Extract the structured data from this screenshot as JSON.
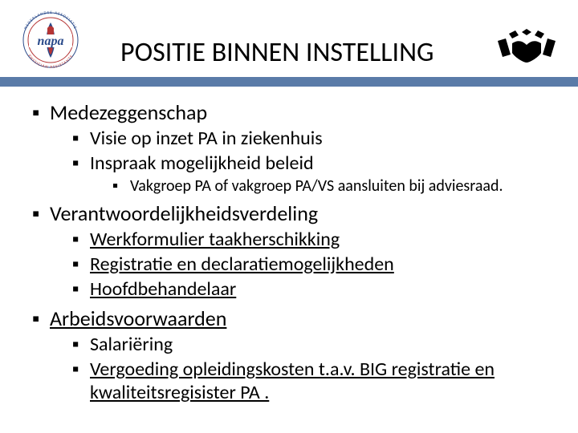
{
  "title": "POSITIE BINNEN INSTELLING",
  "sections": [
    {
      "label": "Medezeggenschap",
      "link": false,
      "items": [
        {
          "label": "Visie op inzet PA in ziekenhuis",
          "link": false,
          "items": []
        },
        {
          "label": "Inspraak mogelijkheid beleid",
          "link": false,
          "items": [
            {
              "label": "Vakgroep PA of vakgroep PA/VS aansluiten bij adviesraad.",
              "link": false
            }
          ]
        }
      ]
    },
    {
      "label": "Verantwoordelijkheidsverdeling",
      "link": false,
      "items": [
        {
          "label": "Werkformulier taakherschikking",
          "link": true,
          "items": []
        },
        {
          "label": "Registratie en declaratiemogelijkheden",
          "link": true,
          "items": []
        },
        {
          "label": "Hoofdbehandelaar",
          "link": true,
          "items": []
        }
      ]
    },
    {
      "label": "Arbeidsvoorwaarden",
      "link": true,
      "items": [
        {
          "label": "Salariëring",
          "link": false,
          "items": []
        },
        {
          "label": "Vergoeding opleidingskosten t.a.v. BIG registratie en kwaliteitsregisister PA .",
          "link": true,
          "items": []
        }
      ]
    }
  ],
  "bullet": "▪"
}
